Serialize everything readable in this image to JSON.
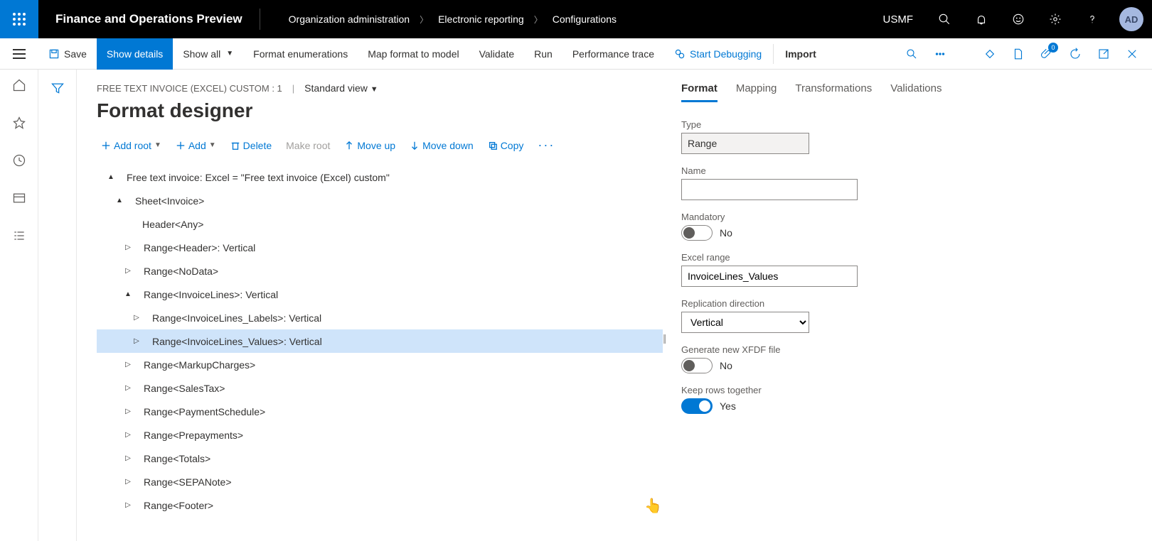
{
  "header": {
    "app_title": "Finance and Operations Preview",
    "breadcrumb": [
      "Organization administration",
      "Electronic reporting",
      "Configurations"
    ],
    "company": "USMF",
    "avatar": "AD"
  },
  "cmdbar": {
    "save": "Save",
    "show_details": "Show details",
    "show_all": "Show all",
    "format_enum": "Format enumerations",
    "map_format": "Map format to model",
    "validate": "Validate",
    "run": "Run",
    "perf_trace": "Performance trace",
    "start_debug": "Start Debugging",
    "import": "Import",
    "badge_count": "0"
  },
  "page": {
    "config_name": "FREE TEXT INVOICE (EXCEL) CUSTOM : 1",
    "view": "Standard view",
    "title": "Format designer"
  },
  "tree_toolbar": {
    "add_root": "Add root",
    "add": "Add",
    "delete": "Delete",
    "make_root": "Make root",
    "move_up": "Move up",
    "move_down": "Move down",
    "copy": "Copy"
  },
  "tree": {
    "root": "Free text invoice: Excel = \"Free text invoice (Excel) custom\"",
    "sheet": "Sheet<Invoice>",
    "header_any": "Header<Any>",
    "range_header": "Range<Header>: Vertical",
    "range_nodata": "Range<NoData>",
    "range_invlines": "Range<InvoiceLines>: Vertical",
    "range_invlines_labels": "Range<InvoiceLines_Labels>: Vertical",
    "range_invlines_values": "Range<InvoiceLines_Values>: Vertical",
    "range_markup": "Range<MarkupCharges>",
    "range_salestax": "Range<SalesTax>",
    "range_paysched": "Range<PaymentSchedule>",
    "range_prepay": "Range<Prepayments>",
    "range_totals": "Range<Totals>",
    "range_sepa": "Range<SEPANote>",
    "range_footer": "Range<Footer>"
  },
  "tabs": {
    "format": "Format",
    "mapping": "Mapping",
    "transformations": "Transformations",
    "validations": "Validations"
  },
  "form": {
    "type_label": "Type",
    "type_value": "Range",
    "name_label": "Name",
    "name_value": "",
    "mandatory_label": "Mandatory",
    "mandatory_value": "No",
    "excel_range_label": "Excel range",
    "excel_range_value": "InvoiceLines_Values",
    "repl_dir_label": "Replication direction",
    "repl_dir_value": "Vertical",
    "gen_xfdf_label": "Generate new XFDF file",
    "gen_xfdf_value": "No",
    "keep_rows_label": "Keep rows together",
    "keep_rows_value": "Yes"
  }
}
